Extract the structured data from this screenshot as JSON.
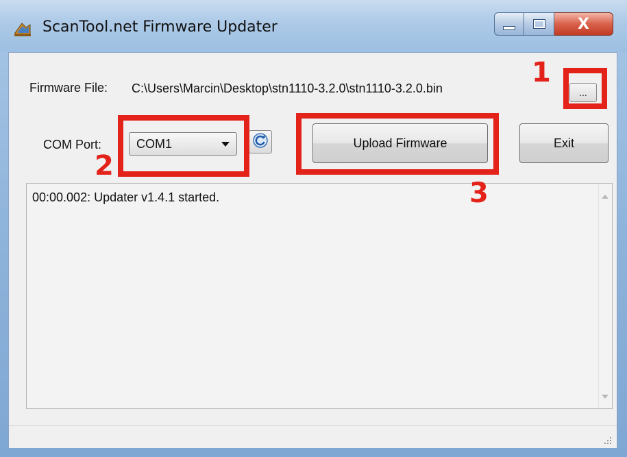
{
  "window": {
    "title": "ScanTool.net Firmware Updater",
    "close_glyph": "X"
  },
  "form": {
    "firmware_file_label": "Firmware File:",
    "firmware_file_path": "C:\\Users\\Marcin\\Desktop\\stn1110-3.2.0\\stn1110-3.2.0.bin",
    "browse_label": "...",
    "com_port_label": "COM Port:",
    "com_port_value": "COM1",
    "upload_label": "Upload Firmware",
    "exit_label": "Exit"
  },
  "log": {
    "lines": [
      "00:00.002: Updater v1.4.1 started."
    ]
  },
  "annotations": {
    "step1": "1",
    "step2": "2",
    "step3": "3",
    "highlight_color": "#e32219"
  },
  "icons": {
    "app": "app-icon",
    "refresh": "refresh-icon",
    "minimize": "minimize-icon",
    "maximize": "maximize-icon",
    "close": "close-icon"
  }
}
